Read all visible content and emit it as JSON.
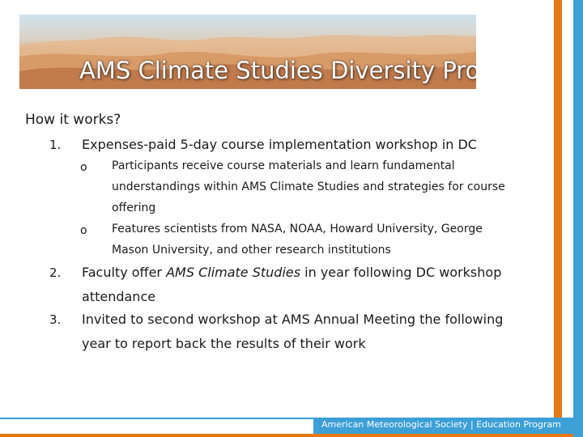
{
  "slide": {
    "title": "AMS Climate Studies Diversity Project",
    "intro": "How it works?",
    "items": [
      {
        "number": "1.",
        "text": "Expenses-paid 5-day course implementation workshop in DC",
        "subitems": [
          {
            "bullet": "o",
            "lines": [
              "Participants receive course materials and learn fundamental",
              "understandings within AMS Climate Studies and strategies for course",
              "offering"
            ]
          },
          {
            "bullet": "o",
            "lines": [
              "Features scientists from NASA, NOAA, Howard University, George",
              "Mason University, and other research institutions"
            ]
          }
        ]
      },
      {
        "number": "2.",
        "line1_before": "Faculty offer ",
        "line1_italic": "AMS Climate Studies",
        "line1_after": " in year following DC workshop",
        "line2": "attendance"
      },
      {
        "number": "3.",
        "line1": "Invited to second workshop at AMS Annual Meeting the following",
        "line2": "year to report back the results of their work"
      }
    ],
    "footer": "American Meteorological Society | Education Program"
  },
  "colors": {
    "accent_orange": "#e77817",
    "accent_blue": "#3c9fd6",
    "title_text": "#ffffff"
  },
  "icons": {
    "bullet_style": "circle-outline"
  }
}
